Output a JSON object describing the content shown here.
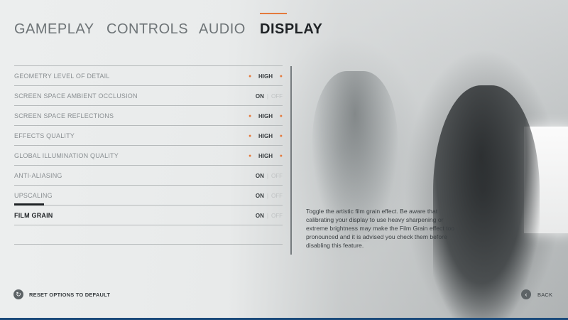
{
  "tabs": [
    {
      "label": "GAMEPLAY",
      "active": false
    },
    {
      "label": "CONTROLS",
      "active": false
    },
    {
      "label": "AUDIO",
      "active": false
    },
    {
      "label": "DISPLAY",
      "active": true
    }
  ],
  "settings": [
    {
      "label": "GEOMETRY LEVEL OF DETAIL",
      "type": "select",
      "value": "HIGH"
    },
    {
      "label": "SCREEN SPACE AMBIENT OCCLUSION",
      "type": "toggle",
      "on": "ON",
      "off": "OFF"
    },
    {
      "label": "SCREEN SPACE REFLECTIONS",
      "type": "select",
      "value": "HIGH"
    },
    {
      "label": "EFFECTS QUALITY",
      "type": "select",
      "value": "HIGH"
    },
    {
      "label": "GLOBAL ILLUMINATION QUALITY",
      "type": "select",
      "value": "HIGH"
    },
    {
      "label": "ANTI-ALIASING",
      "type": "toggle",
      "on": "ON",
      "off": "OFF"
    },
    {
      "label": "UPSCALING",
      "type": "toggle",
      "on": "ON",
      "off": "OFF"
    },
    {
      "label": "FILM GRAIN",
      "type": "toggle",
      "on": "ON",
      "off": "OFF",
      "selected": true
    }
  ],
  "description": "Toggle the artistic film grain effect. Be aware that calibrating your display to use heavy sharpening or extreme brightness may make the Film Grain effect too pronounced and it is advised you check them before disabling this feature.",
  "footer": {
    "reset_label": "RESET OPTIONS TO DEFAULT",
    "reset_icon": "reset-icon",
    "back_label": "BACK",
    "back_icon": "chevron-left-icon"
  },
  "colors": {
    "accent": "#e47a3c",
    "text_dark": "#1f2326",
    "text_muted": "#8a8f92"
  }
}
